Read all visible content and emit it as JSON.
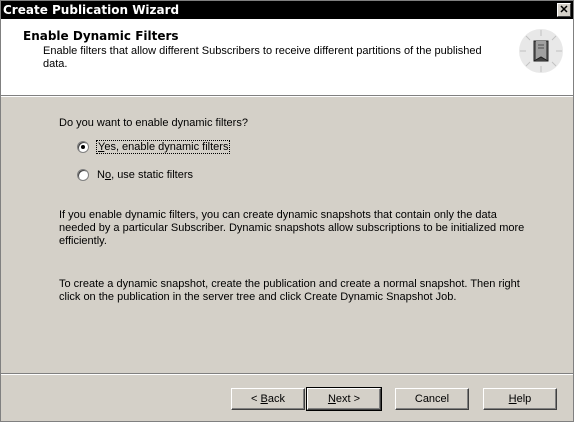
{
  "window": {
    "title": "Create Publication Wizard",
    "close_glyph": "✕"
  },
  "header": {
    "title": "Enable Dynamic Filters",
    "description": "Enable filters that allow different Subscribers to receive different partitions of the published data.",
    "icon": "wizard-book-icon"
  },
  "main": {
    "question": "Do you want to enable dynamic filters?",
    "options": [
      {
        "mnemonic": "Y",
        "label_rest": "es, enable dynamic filters",
        "selected": true
      },
      {
        "label_prefix": "N",
        "mnemonic": "o",
        "label_rest": ", use static filters",
        "selected": false
      }
    ],
    "paragraph1": "If you enable dynamic filters, you can create dynamic snapshots that contain only the data needed by a particular Subscriber. Dynamic snapshots allow subscriptions to be initialized more efficiently.",
    "paragraph2": "To create a dynamic snapshot, create the publication and create a normal snapshot. Then right click on the publication in the server tree and click Create Dynamic Snapshot Job."
  },
  "buttons": {
    "back": {
      "prefix": "< ",
      "mnemonic": "B",
      "rest": "ack"
    },
    "next": {
      "mnemonic": "N",
      "rest": "ext >"
    },
    "cancel": "Cancel",
    "help": {
      "mnemonic": "H",
      "rest": "elp"
    }
  }
}
